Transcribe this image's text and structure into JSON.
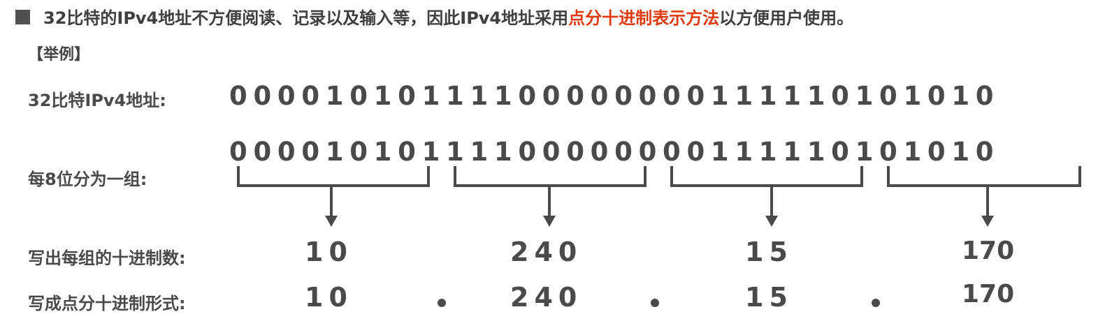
{
  "header": {
    "text_before": "32比特的IPv4地址不方便阅读、记录以及输入等，因此IPv4地址采用",
    "highlight": "点分十进制表示方法",
    "text_after": "以方便用户使用。",
    "highlight_color": "#e03a10"
  },
  "example_label": "【举例】",
  "rows": {
    "bits32_label": "32比特IPv4地址:",
    "group_label": "每8位分为一组:",
    "decimal_label": "写出每组的十进制数:",
    "dotted_label": "写成点分十进制形式:"
  },
  "bits": {
    "group1": "00001010",
    "group2": "11110000",
    "group3": "00001111",
    "group4": "10101010"
  },
  "decimals": {
    "d1": "10",
    "d2": "240",
    "d3": "15",
    "d4": "170"
  },
  "dotted": {
    "d1": "10",
    "d2": "240",
    "d3": "15",
    "d4": "170"
  }
}
